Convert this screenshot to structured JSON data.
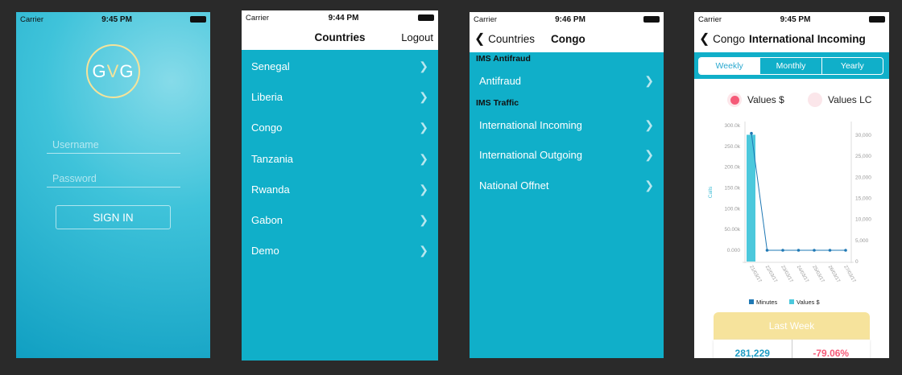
{
  "status": {
    "carrier": "Carrier"
  },
  "login": {
    "time": "9:45 PM",
    "logo_left": "G",
    "logo_mid": "V",
    "logo_right": "G",
    "username_placeholder": "Username",
    "password_placeholder": "Password",
    "sign_in": "SIGN IN",
    "logo_color": "#f5e39a"
  },
  "countries": {
    "time": "9:44 PM",
    "title": "Countries",
    "logout": "Logout",
    "items": [
      "Senegal",
      "Liberia",
      "Congo",
      "Tanzania",
      "Rwanda",
      "Gabon",
      "Demo"
    ]
  },
  "congo": {
    "time": "9:46 PM",
    "back": "Countries",
    "title": "Congo",
    "sections": [
      {
        "header": "IMS Antifraud",
        "items": [
          "Antifraud"
        ]
      },
      {
        "header": "IMS Traffic",
        "items": [
          "International Incoming",
          "International Outgoing",
          "National Offnet"
        ]
      }
    ]
  },
  "detail": {
    "time": "9:45 PM",
    "back": "Congo",
    "title": "International Incoming",
    "tabs": [
      "Weekly",
      "Monthly",
      "Yearly"
    ],
    "active_tab": "Weekly",
    "toggles": [
      {
        "label": "Values $",
        "color": "#f55a78",
        "selected": true
      },
      {
        "label": "Values LC",
        "color": "#fbe3e8",
        "selected": false
      }
    ],
    "card_title": "Last Week",
    "card_value": "281,229",
    "card_change": "-79.06%"
  },
  "chart_data": {
    "type": "bar+line",
    "categories": [
      "21/03/17",
      "22/03/17",
      "23/03/17",
      "24/03/17",
      "25/03/17",
      "26/03/17",
      "27/03/17"
    ],
    "ylabel_left": "Calls",
    "left_ticks": [
      "0.000",
      "50.00k",
      "100.0k",
      "150.0k",
      "200.0k",
      "250.0k",
      "300.0k"
    ],
    "left_range": [
      0,
      300000
    ],
    "right_ticks": [
      "0",
      "5,000",
      "10,000",
      "15,000",
      "20,000",
      "25,000",
      "30,000"
    ],
    "right_range": [
      0,
      30000
    ],
    "series": [
      {
        "name": "Minutes",
        "type": "line",
        "axis": "left",
        "color": "#1f78b4",
        "values": [
          281229,
          0,
          0,
          0,
          0,
          0,
          0
        ]
      },
      {
        "name": "Values $",
        "type": "bar",
        "axis": "right",
        "color": "#4cc8dc",
        "values": [
          30100,
          0,
          0,
          0,
          0,
          0,
          0
        ]
      }
    ],
    "legend": "bottom"
  }
}
